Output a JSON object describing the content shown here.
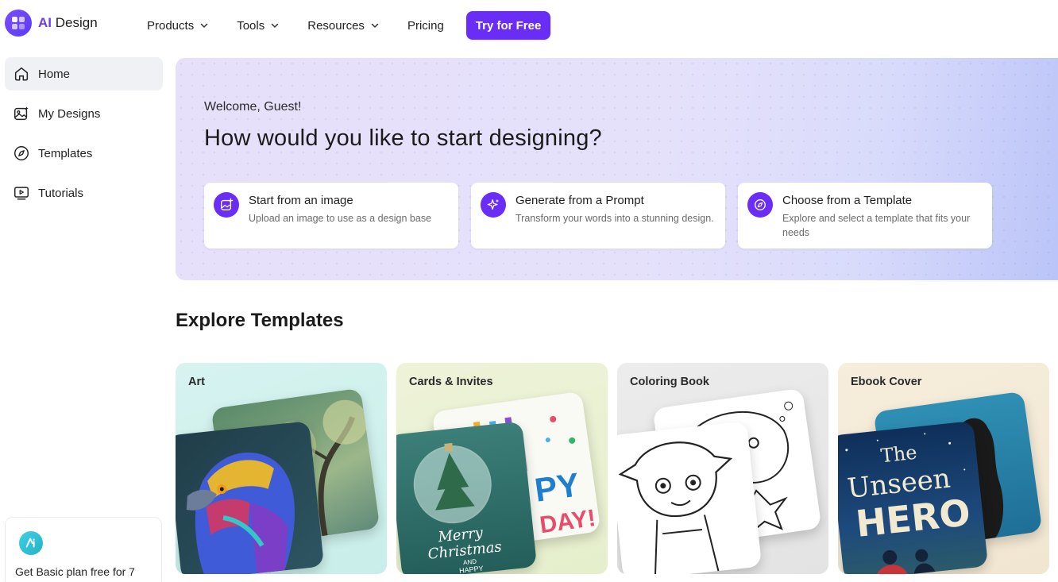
{
  "brand": {
    "ai": "AI",
    "name": "Design"
  },
  "nav": {
    "products": "Products",
    "tools": "Tools",
    "resources": "Resources",
    "pricing": "Pricing",
    "cta": "Try for Free"
  },
  "sidebar": {
    "items": [
      {
        "label": "Home",
        "icon": "home-icon"
      },
      {
        "label": "My Designs",
        "icon": "images-icon"
      },
      {
        "label": "Templates",
        "icon": "compass-icon"
      },
      {
        "label": "Tutorials",
        "icon": "play-icon"
      }
    ],
    "promo": {
      "text": "Get Basic plan free for 7"
    }
  },
  "hero": {
    "welcome": "Welcome, Guest!",
    "title": "How would you like to start designing?",
    "options": [
      {
        "title": "Start from an image",
        "desc": "Upload an image to use as a design base",
        "icon": "image-upload-icon"
      },
      {
        "title": "Generate from a Prompt",
        "desc": "Transform your words into a stunning design.",
        "icon": "sparkle-icon"
      },
      {
        "title": "Choose from a Template",
        "desc": "Explore and select a template that fits your needs",
        "icon": "compass-icon"
      }
    ]
  },
  "explore": {
    "title": "Explore Templates",
    "cards": [
      {
        "label": "Art"
      },
      {
        "label": "Cards & Invites",
        "card_text": [
          "Merry",
          "Christmas",
          "AND",
          "HAPPY"
        ],
        "card_text_back": [
          "PY",
          "DAY!"
        ]
      },
      {
        "label": "Coloring Book"
      },
      {
        "label": "Ebook Cover",
        "cover_text": [
          "The",
          "Unseen",
          "HERO"
        ]
      }
    ]
  },
  "colors": {
    "accent": "#6a2df5",
    "hero_bg": "#e5e1fb",
    "sidebar_active": "#eff1f4"
  }
}
